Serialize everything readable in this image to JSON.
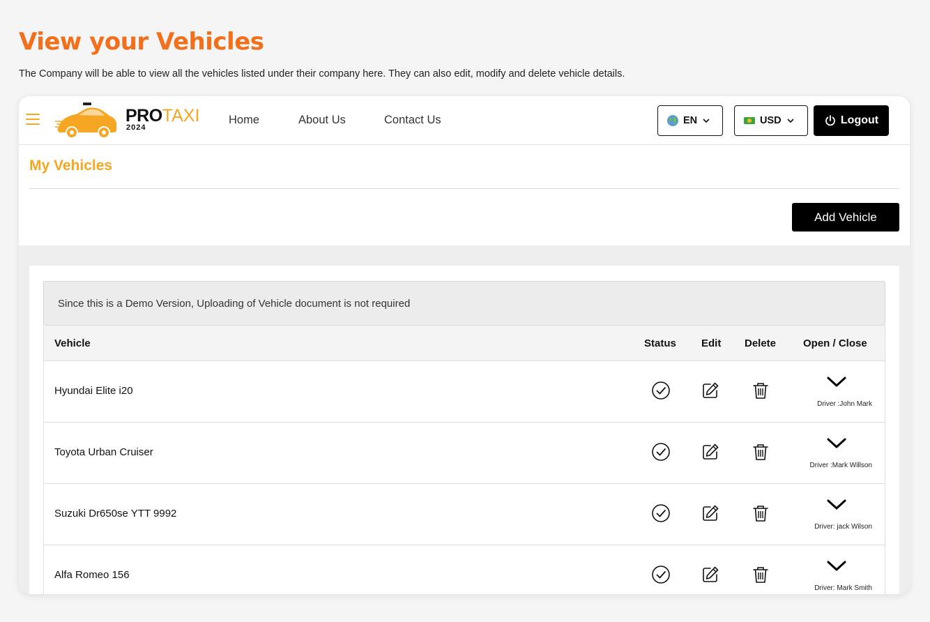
{
  "page": {
    "title": "View your Vehicles",
    "description": "The Company will be able to view all the vehicles listed under their company here. They can also edit, modify and delete vehicle details."
  },
  "nav": {
    "logo": {
      "brand_bold": "PRO",
      "brand_accent": "TAXI",
      "year": "2024"
    },
    "links": [
      "Home",
      "About Us",
      "Contact Us"
    ],
    "language": {
      "icon": "globe-icon",
      "value": "EN"
    },
    "currency": {
      "icon": "banknote-icon",
      "value": "USD"
    },
    "logout_label": "Logout"
  },
  "section": {
    "title": "My Vehicles",
    "add_button_label": "Add Vehicle"
  },
  "notice": "Since this is a Demo Version, Uploading of Vehicle document is not required",
  "table": {
    "headers": {
      "vehicle": "Vehicle",
      "status": "Status",
      "edit": "Edit",
      "delete": "Delete",
      "toggle": "Open / Close"
    },
    "rows": [
      {
        "vehicle": "Hyundai Elite i20",
        "driver": "Driver :John Mark"
      },
      {
        "vehicle": "Toyota Urban Cruiser",
        "driver": "Driver :Mark Willson"
      },
      {
        "vehicle": "Suzuki Dr650se YTT 9992",
        "driver": "Driver: jack Wilson"
      },
      {
        "vehicle": "Alfa Romeo 156",
        "driver": "Driver: Mark Smith"
      }
    ]
  },
  "colors": {
    "title_orange": "#f26f1b",
    "accent_yellow": "#f5a623",
    "button_black": "#000000"
  }
}
